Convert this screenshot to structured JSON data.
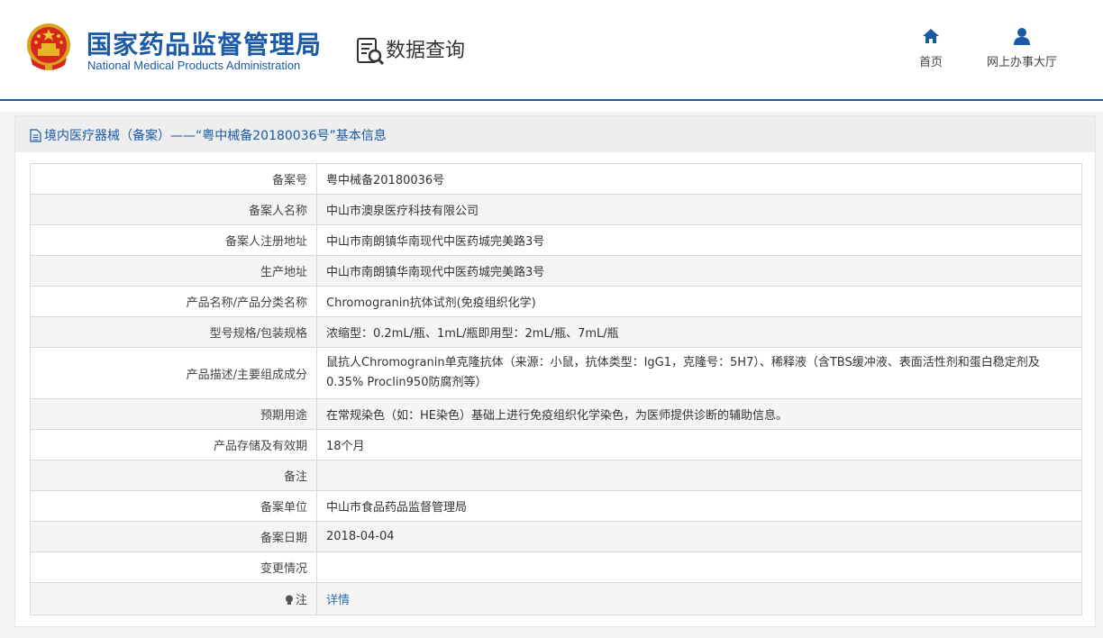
{
  "header": {
    "agency_cn": "国家药品监督管理局",
    "agency_en": "National Medical Products Administration",
    "section_title": "数据查询",
    "nav": [
      {
        "label": "首页",
        "icon": "home-icon"
      },
      {
        "label": "网上办事大厅",
        "icon": "user-icon"
      }
    ]
  },
  "panel": {
    "title": "境内医疗器械（备案）——“粤中械备20180036号”基本信息"
  },
  "rows": [
    {
      "label": "备案号",
      "value": "粤中械备20180036号"
    },
    {
      "label": "备案人名称",
      "value": "中山市澳泉医疗科技有限公司"
    },
    {
      "label": "备案人注册地址",
      "value": "中山市南朗镇华南现代中医药城完美路3号"
    },
    {
      "label": "生产地址",
      "value": "中山市南朗镇华南现代中医药城完美路3号"
    },
    {
      "label": "产品名称/产品分类名称",
      "value": "Chromogranin抗体试剂(免疫组织化学)"
    },
    {
      "label": "型号规格/包装规格",
      "value": "浓缩型：0.2mL/瓶、1mL/瓶即用型：2mL/瓶、7mL/瓶"
    },
    {
      "label": "产品描述/主要组成成分",
      "value": "鼠抗人Chromogranin单克隆抗体（来源：小鼠，抗体类型：IgG1，克隆号：5H7）、稀释液（含TBS缓冲液、表面活性剂和蛋白稳定剂及0.35% Proclin950防腐剂等）"
    },
    {
      "label": "预期用途",
      "value": "在常规染色（如：HE染色）基础上进行免疫组织化学染色，为医师提供诊断的辅助信息。"
    },
    {
      "label": "产品存储及有效期",
      "value": "18个月"
    },
    {
      "label": "备注",
      "value": ""
    },
    {
      "label": "备案单位",
      "value": "中山市食品药品监督管理局"
    },
    {
      "label": "备案日期",
      "value": "2018-04-04"
    },
    {
      "label": "变更情况",
      "value": ""
    },
    {
      "label": "注",
      "value": "详情"
    }
  ],
  "colors": {
    "brand_blue": "#1a5aa6",
    "link_blue": "#2a6db5",
    "header_rule": "#1c5ca8"
  }
}
